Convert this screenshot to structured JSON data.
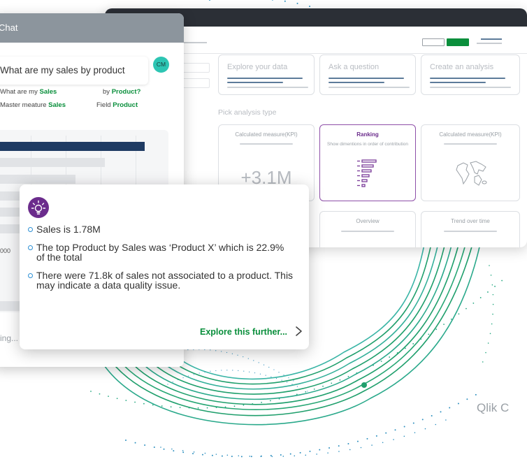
{
  "colors": {
    "green_accent": "#0a8f3c",
    "purple_accent": "#6b2c8c",
    "teal_avatar": "#2dc5b3",
    "bar_dark": "#1f3b63",
    "chat_header": "#8c959d",
    "bullet_blue": "#2b8fd4"
  },
  "analysis_window": {
    "action_cards": [
      "Explore your data",
      "Ask a question",
      "Create an analysis"
    ],
    "section_label": "Pick analysis type",
    "type_cards": [
      {
        "title": "Calculated measure(KPI)",
        "value": "+3.1M"
      },
      {
        "title": "Ranking",
        "subtitle": "Show dimentions in order of contribution"
      },
      {
        "title": "Calculated measure(KPI)"
      },
      {
        "title": "Overview"
      },
      {
        "title": "Trend over time"
      }
    ],
    "icons": [
      "funnel-ranking-icon",
      "world-map-icon"
    ]
  },
  "chat": {
    "title": "Chat",
    "question": "What are my sales by product",
    "avatar_initials": "CM",
    "tokens": {
      "left_1_prefix": "What are my ",
      "left_1_term": "Sales",
      "right_1_prefix": "by ",
      "right_1_term": "Product?",
      "left_2_prefix": "Master meature ",
      "left_2_term": "Sales",
      "right_2_prefix": "Field ",
      "right_2_term": "Product"
    },
    "axis_tick": "000",
    "input_placeholder": "ing..."
  },
  "insight": {
    "icon": "lightbulb-insight-icon",
    "bullets": [
      "Sales is 1.78M",
      "The top Product by Sales was ‘Product X’ which is 22.9% of the total",
      "There were 71.8k of sales not associated to a product. This may indicate a data quality issue."
    ],
    "explore_link": "Explore this further...",
    "explore_icon": "chevron-right-icon"
  },
  "brand_text": "Qlik C"
}
